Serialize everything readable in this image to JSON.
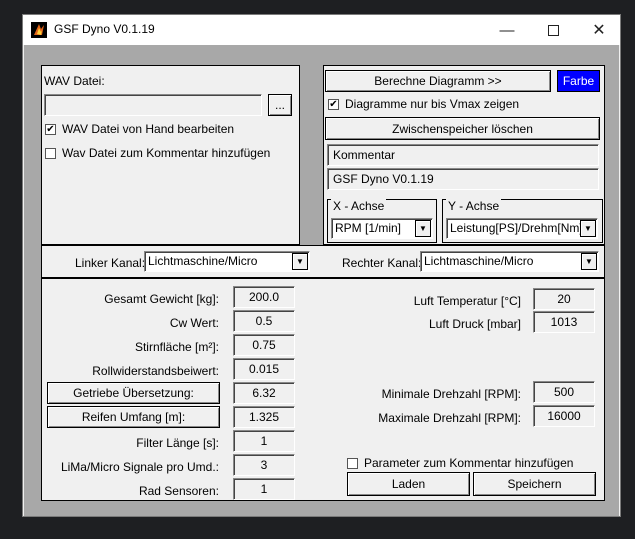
{
  "window": {
    "title": "GSF Dyno V0.1.19"
  },
  "wav": {
    "label": "WAV Datei:",
    "path_value": "",
    "browse_label": "...",
    "edit_by_hand_label": "WAV Datei von Hand bearbeiten",
    "edit_by_hand_checked": true,
    "add_to_comment_label": "Wav Datei zum Kommentar hinzufügen",
    "add_to_comment_checked": false
  },
  "chart": {
    "calc_button": "Berechne Diagramm >>",
    "color_button": "Farbe",
    "color_button_bg": "#0000ff",
    "only_vmax_label": "Diagramme nur bis Vmax zeigen",
    "only_vmax_checked": true,
    "clear_cache_button": "Zwischenspeicher löschen",
    "comment_label": "Kommentar",
    "comment_value": "GSF Dyno V0.1.19",
    "x_axis_title": "X - Achse",
    "x_axis_value": "RPM [1/min]",
    "y_axis_title": "Y - Achse",
    "y_axis_value": "Leistung[PS]/Drehm[Nm]"
  },
  "channels": {
    "left_label": "Linker Kanal:",
    "left_value": "Lichtmaschine/Micro",
    "right_label": "Rechter Kanal:",
    "right_value": "Lichtmaschine/Micro"
  },
  "params": {
    "weight_label": "Gesamt Gewicht [kg]:",
    "weight_value": "200.0",
    "cw_label": "Cw Wert:",
    "cw_value": "0.5",
    "area_label": "Stirnfläche [m²]:",
    "area_value": "0.75",
    "roll_label": "Rollwiderstandsbeiwert:",
    "roll_value": "0.015",
    "gear_button": "Getriebe Übersetzung:",
    "gear_value": "6.32",
    "tire_button": "Reifen Umfang [m]:",
    "tire_value": "1.325",
    "filter_label": "Filter Länge [s]:",
    "filter_value": "1",
    "signals_label": "LiMa/Micro Signale pro Umd.:",
    "signals_value": "3",
    "sensors_label": "Rad Sensoren:",
    "sensors_value": "1",
    "air_temp_label": "Luft Temperatur [°C]",
    "air_temp_value": "20",
    "air_pressure_label": "Luft Druck [mbar]",
    "air_pressure_value": "1013",
    "min_rpm_label": "Minimale Drehzahl [RPM]:",
    "min_rpm_value": "500",
    "max_rpm_label": "Maximale Drehzahl [RPM]:",
    "max_rpm_value": "16000",
    "add_params_label": "Parameter zum Kommentar hinzufügen",
    "add_params_checked": false,
    "load_button": "Laden",
    "save_button": "Speichern"
  },
  "icons": [
    "app-icon",
    "minimize-icon",
    "maximize-icon",
    "close-icon",
    "checkmark-icon",
    "dropdown-arrow-icon"
  ]
}
